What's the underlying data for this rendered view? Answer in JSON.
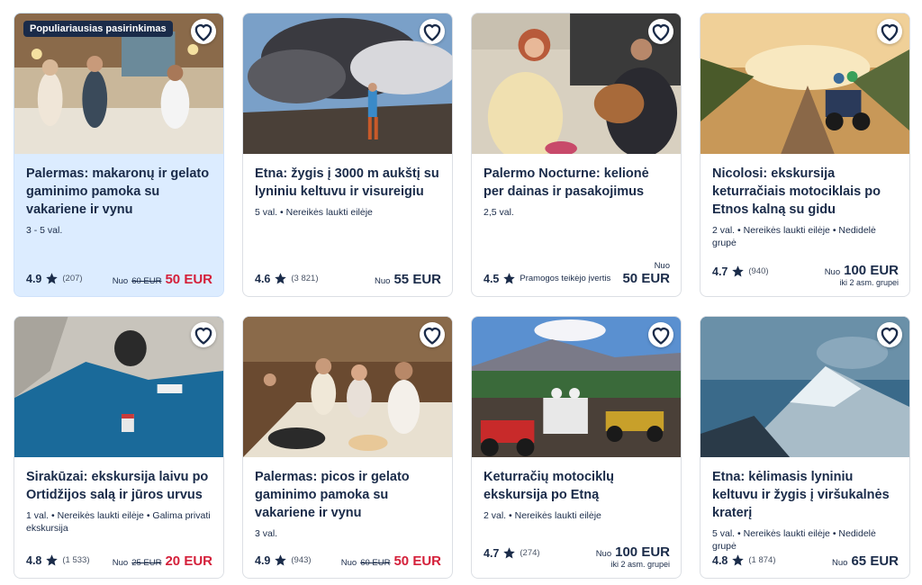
{
  "cards": [
    {
      "badge": "Populiariausias pasirinkimas",
      "title": "Palermas: makaronų ir gelato gaminimo pamoka su vakariene ir vynu",
      "meta": "3 - 5 val.",
      "score": "4.9",
      "count": "(207)",
      "from": "Nuo",
      "old": "60 EUR",
      "price": "50 EUR"
    },
    {
      "title": "Etna: žygis į 3000 m aukštį su lyniniu keltuvu ir visureigiu",
      "meta": "5 val. • Nereikės laukti eilėje",
      "score": "4.6",
      "count": "(3 821)",
      "from": "Nuo",
      "price": "55 EUR"
    },
    {
      "title": "Palermo Nocturne: kelionė per dainas ir pasakojimus",
      "meta": "2,5 val.",
      "score": "4.5",
      "rating_text": "Pramogos teikėjo įvertis",
      "from": "Nuo",
      "price": "50 EUR"
    },
    {
      "title": "Nicolosi: ekskursija keturračiais motociklais po Etnos kalną su gidu",
      "meta": "2 val. • Nereikės laukti eilėje • Nedidelė grupė",
      "score": "4.7",
      "count": "(940)",
      "from": "Nuo",
      "price": "100 EUR",
      "sub": "iki 2 asm. grupei"
    },
    {
      "title": "Sirakūzai: ekskursija laivu po Ortidžijos salą ir jūros urvus",
      "meta": "1 val. • Nereikės laukti eilėje • Galima privati ekskursija",
      "score": "4.8",
      "count": "(1 533)",
      "from": "Nuo",
      "old": "25 EUR",
      "price": "20 EUR"
    },
    {
      "title": "Palermas: picos ir gelato gaminimo pamoka su vakariene ir vynu",
      "meta": "3 val.",
      "score": "4.9",
      "count": "(943)",
      "from": "Nuo",
      "old": "60 EUR",
      "price": "50 EUR"
    },
    {
      "title": "Keturračių motociklų ekskursija po Etną",
      "meta": "2 val. • Nereikės laukti eilėje",
      "score": "4.7",
      "count": "(274)",
      "from": "Nuo",
      "price": "100 EUR",
      "sub": "iki 2 asm. grupei"
    },
    {
      "title": "Etna: kėlimasis lyniniu keltuvu ir žygis į viršukalnės kraterį",
      "meta": "5 val. • Nereikės laukti eilėje • Nedidelė grupė",
      "score": "4.8",
      "count": "(1 874)",
      "from": "Nuo",
      "price": "65 EUR"
    }
  ],
  "colors": {
    "navy": "#1a2b49",
    "sale": "#d4203a",
    "featured_bg": "#dcecff"
  },
  "icons": {
    "wishlist": "heart-icon",
    "rating": "star-icon"
  }
}
